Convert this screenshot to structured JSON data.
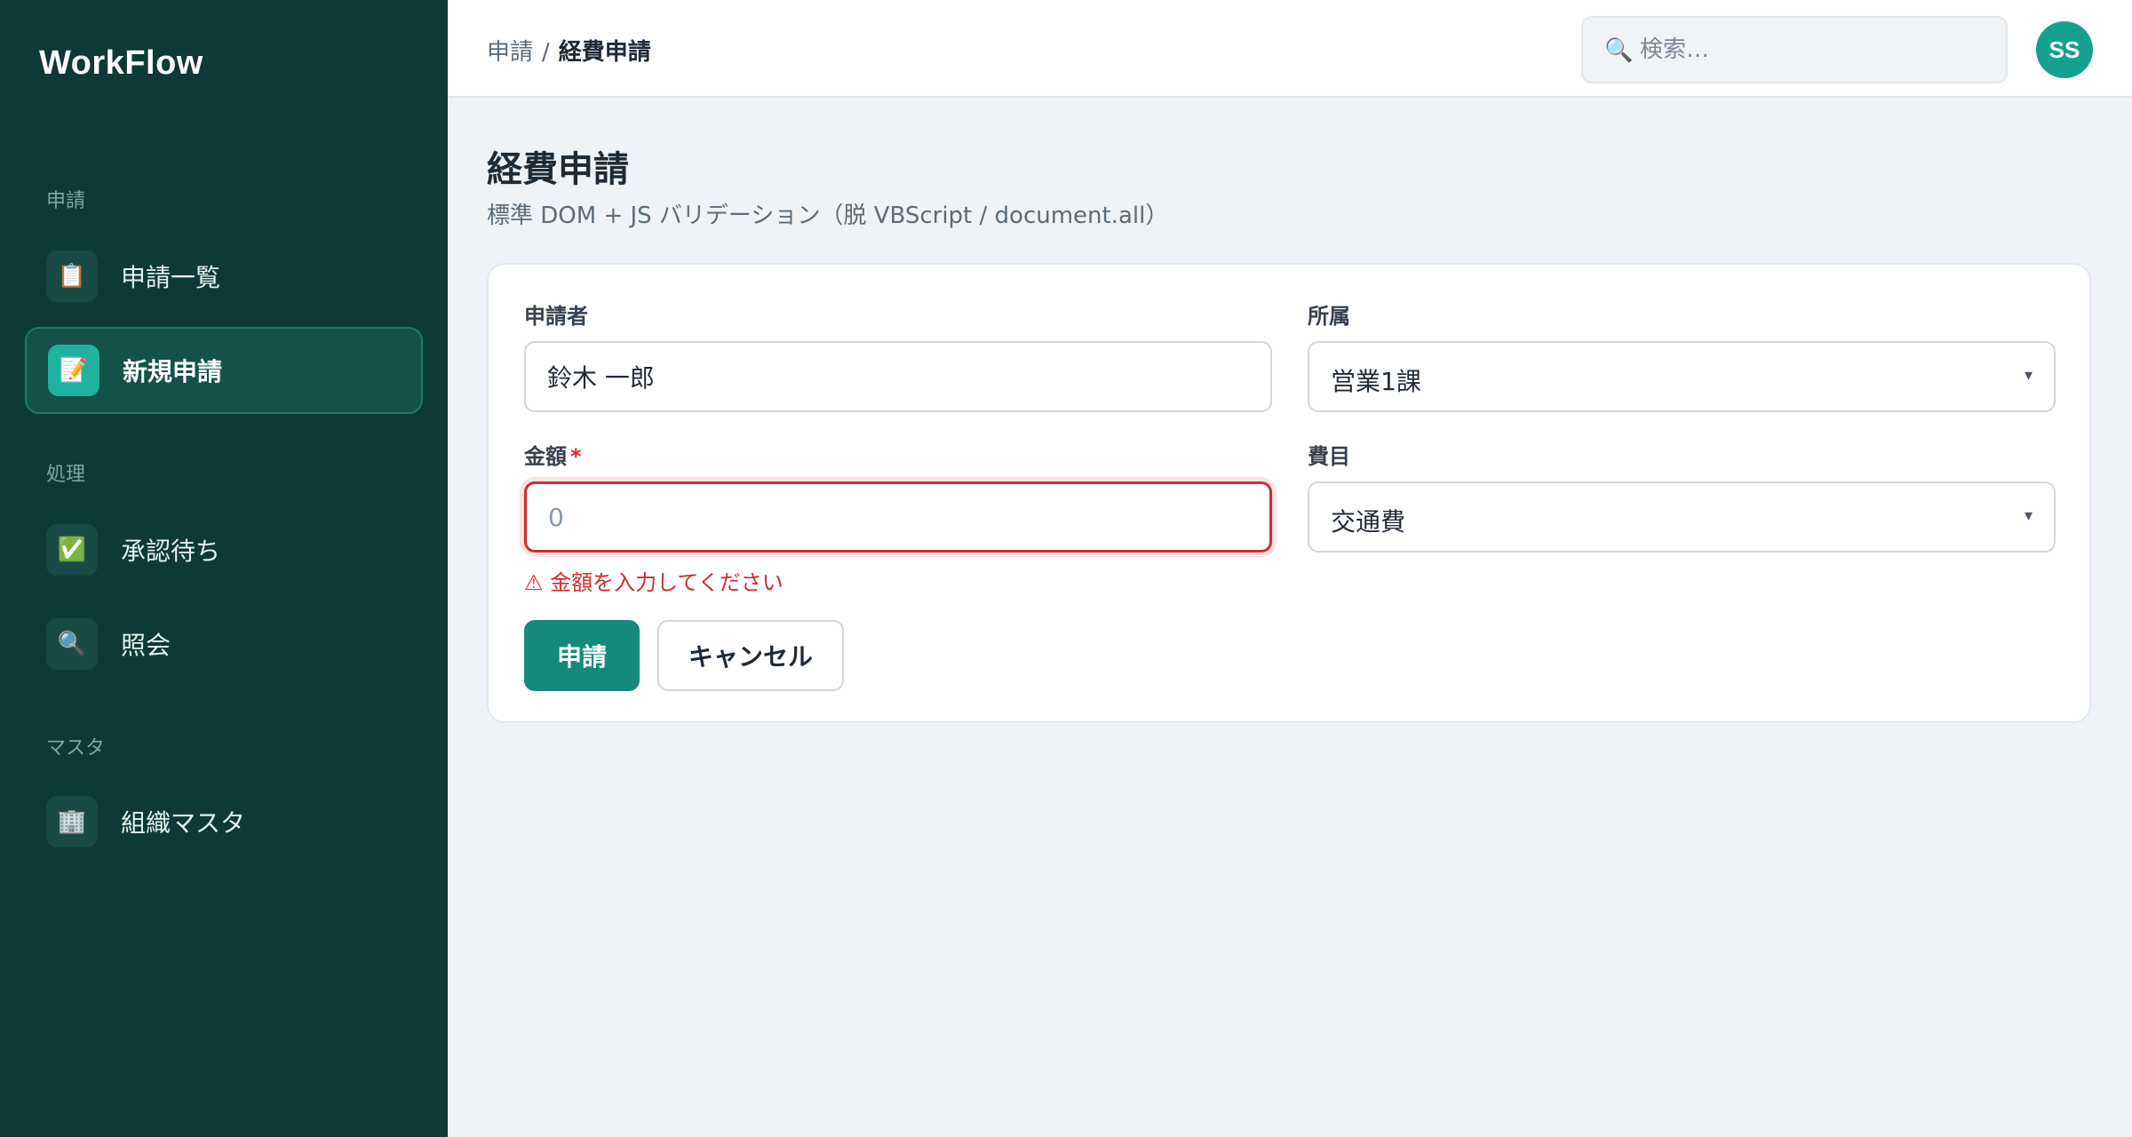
{
  "sidebar": {
    "brand": "WorkFlow",
    "sections": [
      {
        "label": "申請"
      },
      {
        "label": "処理"
      },
      {
        "label": "マスタ"
      }
    ],
    "items": [
      {
        "label": "申請一覧",
        "icon": "📋",
        "icon_name": "clipboard-icon"
      },
      {
        "label": "新規申請",
        "icon": "📝",
        "icon_name": "memo-icon",
        "active": true
      },
      {
        "label": "承認待ち",
        "icon": "✅",
        "icon_name": "check-icon"
      },
      {
        "label": "照会",
        "icon": "🔍",
        "icon_name": "magnifier-icon"
      },
      {
        "label": "組織マスタ",
        "icon": "🏢",
        "icon_name": "building-icon"
      }
    ]
  },
  "header": {
    "breadcrumb": {
      "parent": "申請",
      "separator": "/",
      "current": "経費申請"
    },
    "search": {
      "icon": "🔍",
      "placeholder": "検索…",
      "value": ""
    },
    "avatar": {
      "initials": "SS",
      "color": "#14a08f"
    }
  },
  "main": {
    "title": "経費申請",
    "subtitle": "標準 DOM + JS バリデーション（脱 VBScript / document.all）",
    "form": {
      "applicant": {
        "label": "申請者",
        "value": "鈴木 一郎"
      },
      "department": {
        "label": "所属",
        "value": "営業1課",
        "chevron": "▾"
      },
      "amount": {
        "label": "金額",
        "required_mark": "*",
        "placeholder": "0",
        "value": "",
        "error": "⚠ 金額を入力してください"
      },
      "category": {
        "label": "費目",
        "value": "交通費",
        "chevron": "▾"
      },
      "submit_label": "申請",
      "cancel_label": "キャンセル"
    }
  },
  "colors": {
    "sidebar_bg": "#0d3a36",
    "accent": "#14897c",
    "error": "#d12c2c"
  }
}
